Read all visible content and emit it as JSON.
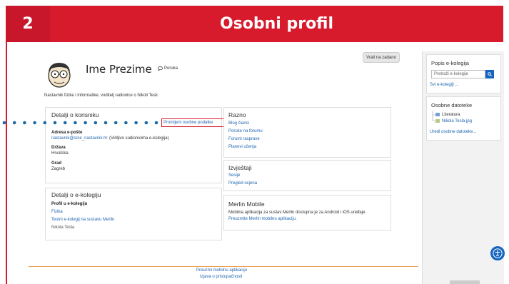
{
  "banner": {
    "number": "2",
    "title": "Osobni profil"
  },
  "profile": {
    "back_button": "Vrati na zadano",
    "name": "Ime Prezime",
    "message_label": "Poruka",
    "description": "Nastavnik fizike i informatike, voditelj radionice o Nikoli Tesli."
  },
  "user_details": {
    "title": "Detalji o korisniku",
    "edit_link": "Promijeni osobne podatke",
    "email_label": "Adresa e-pošte",
    "email_value": "nastavnik@srce_nastavnik.hr",
    "email_note": "(Vidljivo sudionicima e-kolegija)",
    "country_label": "Država",
    "country_value": "Hrvatska",
    "city_label": "Grad",
    "city_value": "Zagreb"
  },
  "course_details": {
    "title": "Detalji o e-kolegiju",
    "profiles_label": "Profil u e-kolegiju",
    "items": [
      "Fizika",
      "Testni e-kolegij na sustavu Merlin",
      "Nikola Tesla"
    ]
  },
  "misc": {
    "title": "Razno",
    "links": [
      "Blog članci",
      "Poruke na forumu",
      "Forumi rasprave",
      "Planovi učenja"
    ]
  },
  "reports": {
    "title": "Izvještaji",
    "links": [
      "Sesije",
      "Pregled ocjena"
    ]
  },
  "mobile": {
    "title": "Merlin Mobile",
    "text": "Mobilna aplikacija za sustav Merlin dostupna je za Android i iOS uređaje.",
    "link": "Preuzmite Merlin mobilnu aplikaciju."
  },
  "sidebar": {
    "courses_title": "Popis e-kolegija",
    "search_placeholder": "Pretraži e-kolegije",
    "all_courses": "Svi e-kolegiji ...",
    "files_title": "Osobne datoteke",
    "folder": "Literatura",
    "file": "Nikola Tesla.jpg",
    "edit_files": "Uredi osobne datoteke..."
  },
  "footer": {
    "link1": "Preuzmi mobilnu aplikaciju",
    "link2": "Izjava o pristupačnosti"
  },
  "colors": {
    "accent": "#d71a2c",
    "link": "#2166b0",
    "button": "#1565c0"
  }
}
